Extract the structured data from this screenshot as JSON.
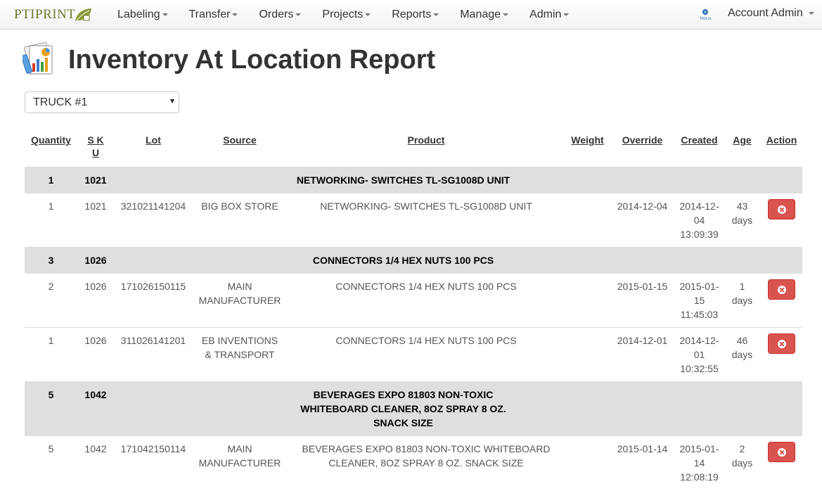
{
  "brand": {
    "name": "PTIPRINT"
  },
  "nav": {
    "items": [
      {
        "label": "Labeling"
      },
      {
        "label": "Transfer"
      },
      {
        "label": "Orders"
      },
      {
        "label": "Projects"
      },
      {
        "label": "Reports"
      },
      {
        "label": "Manage"
      },
      {
        "label": "Admin"
      }
    ],
    "account_label": "Account Admin",
    "trx_badge": "TRX.io"
  },
  "page": {
    "title": "Inventory At Location Report"
  },
  "location_select": {
    "value": "TRUCK #1"
  },
  "table": {
    "headers": {
      "quantity": "Quantity",
      "sku_1": "S K",
      "sku_2": "U",
      "lot": "Lot",
      "source": "Source",
      "product": "Product",
      "weight": "Weight",
      "override": "Override",
      "created": "Created",
      "age": "Age",
      "action": "Action"
    },
    "groups": [
      {
        "quantity": "1",
        "sku": "1021",
        "product_lines": [
          "NETWORKING- SWITCHES TL-SG1008D UNIT"
        ],
        "rows": [
          {
            "quantity": "1",
            "sku": "1021",
            "lot": "321021141204",
            "source_lines": [
              "BIG BOX STORE"
            ],
            "product_lines": [
              "NETWORKING- SWITCHES TL-SG1008D UNIT"
            ],
            "weight": "",
            "override": "2014-12-04",
            "created_lines": [
              "2014-12-",
              "04",
              "13:09:39"
            ],
            "age_lines": [
              "43",
              "days"
            ]
          }
        ]
      },
      {
        "quantity": "3",
        "sku": "1026",
        "product_lines": [
          "CONNECTORS 1/4 HEX NUTS 100 PCS"
        ],
        "rows": [
          {
            "quantity": "2",
            "sku": "1026",
            "lot": "171026150115",
            "source_lines": [
              "MAIN",
              "MANUFACTURER"
            ],
            "product_lines": [
              "CONNECTORS 1/4 HEX NUTS 100 PCS"
            ],
            "weight": "",
            "override": "2015-01-15",
            "created_lines": [
              "2015-01-",
              "15",
              "11:45:03"
            ],
            "age_lines": [
              "1",
              "days"
            ]
          },
          {
            "quantity": "1",
            "sku": "1026",
            "lot": "311026141201",
            "source_lines": [
              "EB INVENTIONS",
              "& TRANSPORT"
            ],
            "product_lines": [
              "CONNECTORS 1/4 HEX NUTS 100 PCS"
            ],
            "weight": "",
            "override": "2014-12-01",
            "created_lines": [
              "2014-12-",
              "01",
              "10:32:55"
            ],
            "age_lines": [
              "46",
              "days"
            ]
          }
        ]
      },
      {
        "quantity": "5",
        "sku": "1042",
        "product_lines": [
          "BEVERAGES EXPO 81803 NON-TOXIC",
          "WHITEBOARD CLEANER, 8OZ SPRAY 8 OZ.",
          "SNACK SIZE"
        ],
        "rows": [
          {
            "quantity": "5",
            "sku": "1042",
            "lot": "171042150114",
            "source_lines": [
              "MAIN",
              "MANUFACTURER"
            ],
            "product_lines": [
              "BEVERAGES EXPO 81803 NON-TOXIC WHITEBOARD",
              "CLEANER, 8OZ SPRAY 8 OZ. SNACK SIZE"
            ],
            "weight": "",
            "override": "2015-01-14",
            "created_lines": [
              "2015-01-",
              "14",
              "12:08:19"
            ],
            "age_lines": [
              "2",
              "days"
            ]
          }
        ]
      }
    ]
  },
  "colors": {
    "brand": "#6d7a2e",
    "group_row_bg": "#dfdfdf",
    "danger": "#d9534f"
  }
}
